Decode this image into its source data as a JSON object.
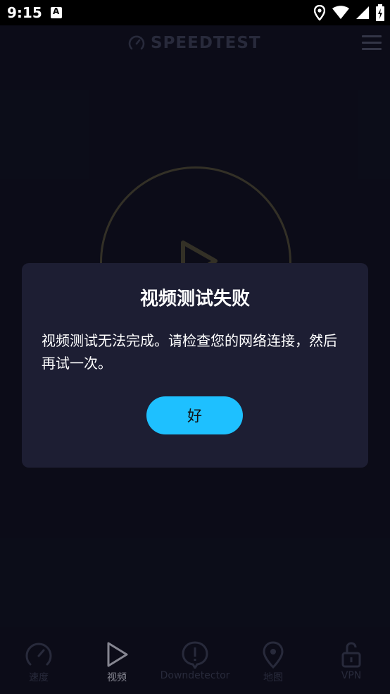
{
  "status_bar": {
    "time": "9:15"
  },
  "app_bar": {
    "title": "SPEEDTEST"
  },
  "dialog": {
    "title": "视频测试失败",
    "message": "视频测试无法完成。请检查您的网络连接，然后再试一次。",
    "ok_label": "好"
  },
  "bottom_nav": [
    {
      "label": "速度",
      "icon": "speed-gauge-icon",
      "active": false
    },
    {
      "label": "视频",
      "icon": "play-icon",
      "active": true
    },
    {
      "label": "Downdetector",
      "icon": "alert-icon",
      "active": false
    },
    {
      "label": "地图",
      "icon": "map-pin-icon",
      "active": false
    },
    {
      "label": "VPN",
      "icon": "unlock-icon",
      "active": false
    }
  ],
  "colors": {
    "background": "#0e0f1d",
    "dialog": "#1d1e33",
    "accent": "#1ec0ff"
  }
}
